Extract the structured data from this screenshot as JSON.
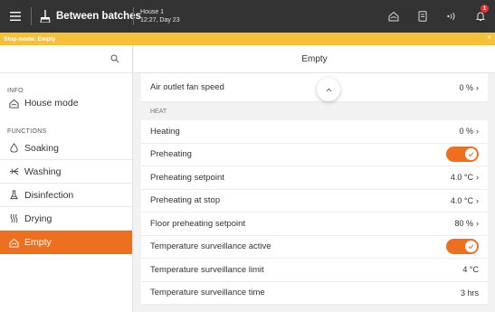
{
  "header": {
    "title": "Between batches",
    "house_name": "House 1",
    "house_time": "12:27, Day 23",
    "notification_count": "1"
  },
  "stop_bar": {
    "text": "Stop mode: Empty",
    "close": "×"
  },
  "sidebar": {
    "info_label": "INFO",
    "house_mode": "House mode",
    "functions_label": "FUNCTIONS",
    "items": [
      {
        "label": "Soaking",
        "icon": "soaking-icon"
      },
      {
        "label": "Washing",
        "icon": "washing-icon"
      },
      {
        "label": "Disinfection",
        "icon": "disinfection-icon"
      },
      {
        "label": "Drying",
        "icon": "drying-icon"
      },
      {
        "label": "Empty",
        "icon": "empty-icon",
        "active": true
      }
    ]
  },
  "main": {
    "title": "Empty",
    "air_outlet": {
      "label": "Air outlet fan speed",
      "value": "0 %"
    },
    "heat_section": "HEAT",
    "rows": [
      {
        "label": "Heating",
        "value": "0 %",
        "chevron": true
      },
      {
        "label": "Preheating",
        "toggle": true
      },
      {
        "label": "Preheating setpoint",
        "value": "4.0 °C",
        "chevron": true
      },
      {
        "label": "Preheating at stop",
        "value": "4.0 °C",
        "chevron": true
      },
      {
        "label": "Floor preheating setpoint",
        "value": "80 %",
        "chevron": true
      },
      {
        "label": "Temperature surveillance active",
        "toggle": true
      },
      {
        "label": "Temperature surveillance limit",
        "value": "4 °C",
        "chevron": false
      },
      {
        "label": "Temperature surveillance time",
        "value": "3 hrs",
        "chevron": false
      }
    ],
    "chevron": "›"
  },
  "colors": {
    "topbar": "#333333",
    "accent": "#ec7020",
    "stop_bar": "#f5c13b",
    "badge": "#e5322d"
  }
}
